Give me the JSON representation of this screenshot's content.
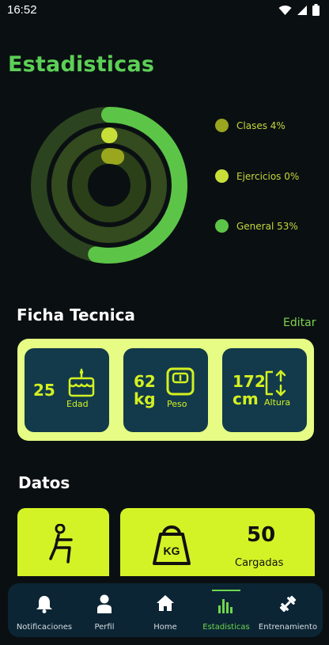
{
  "status_bar": {
    "time": "16:52"
  },
  "page": {
    "title": "Estadisticas"
  },
  "progress": {
    "items": [
      {
        "label": "Clases 4%",
        "value": 0.04,
        "color": "#99a61e",
        "track": "#2b4019"
      },
      {
        "label": "Ejercicios 0%",
        "value": 0.0,
        "color": "#c8df3a",
        "track": "#344a1f"
      },
      {
        "label": "General 53%",
        "value": 0.53,
        "color": "#5cc548",
        "track": "#2c4320"
      }
    ]
  },
  "ficha": {
    "title": "Ficha Tecnica",
    "edit_label": "Editar",
    "edad": {
      "value": "25",
      "label": "Edad",
      "icon": "birthday-cake-icon"
    },
    "peso": {
      "value": "62",
      "unit": "kg",
      "label": "Peso",
      "icon": "scale-icon"
    },
    "altura": {
      "value": "172",
      "unit": "cm",
      "label": "Altura",
      "icon": "height-arrows-icon"
    }
  },
  "datos": {
    "title": "Datos",
    "cargadas_count": "50",
    "cargadas_label": "Cargadas",
    "exercise_icon": "squat-icon",
    "weight_icon": "kettlebell-icon",
    "weight_icon_text": "KG"
  },
  "nav": {
    "items": [
      {
        "label": "Notificaciones",
        "icon": "bell-icon"
      },
      {
        "label": "Perfil",
        "icon": "user-icon"
      },
      {
        "label": "Home",
        "icon": "home-icon"
      },
      {
        "label": "Estadisticas",
        "icon": "bar-chart-icon",
        "active": true
      },
      {
        "label": "Entrenamiento",
        "icon": "dumbbell-icon"
      }
    ]
  },
  "colors": {
    "accent": "#5cd056",
    "lime": "#d4f326",
    "panel": "#e6fc84",
    "card": "#123a4b",
    "nav_bg": "#0c2534"
  }
}
